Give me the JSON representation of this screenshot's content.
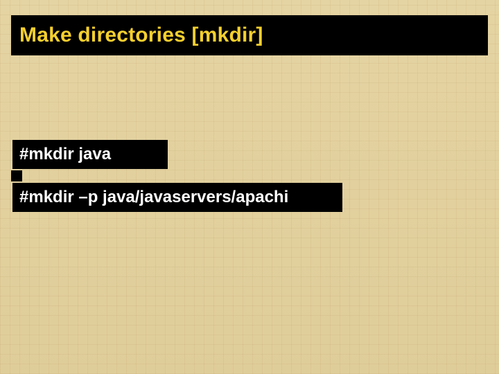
{
  "title": "Make directories [mkdir]",
  "commands": {
    "cmd1": "#mkdir java",
    "cmd2": "#mkdir –p java/javaservers/apachi"
  }
}
